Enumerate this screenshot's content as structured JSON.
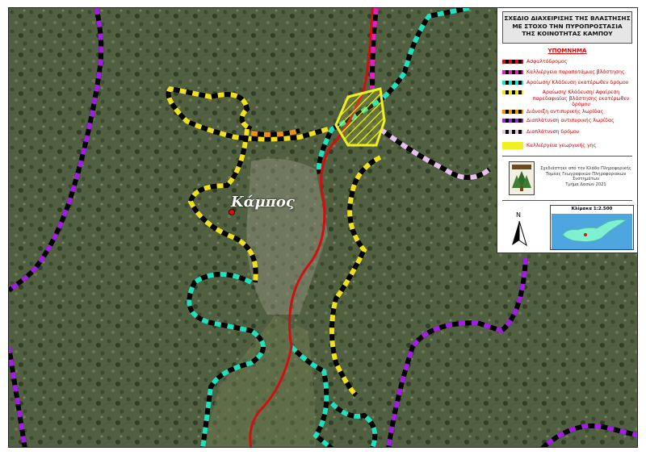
{
  "map": {
    "village_label": "Κάμπος"
  },
  "legend": {
    "title_line1": "ΣΧΕΔΙΟ ΔΙΑΧΕΙΡΙΣΗΣ ΤΗΣ ΒΛΑΣΤΗΣΗΣ",
    "title_line2": "ΜΕ ΣΤΟΧΟ ΤΗΝ ΠΥΡΟΠΡΟΣΤΑΣΙΑ",
    "title_line3": "ΤΗΣ ΚΟΙΝΟΤΗΤΑΣ ΚΑΜΠΟΥ",
    "heading": "ΥΠΟΜΝΗΜΑ",
    "items": [
      {
        "label": "Ασφαλτόδρομος",
        "color1": "#d01010",
        "color2": "#000000"
      },
      {
        "label": "Καλλιέργεια παραποτάμιας βλάστησης",
        "color1": "#e020c0",
        "color2": "#000000"
      },
      {
        "label": "Αραίωση/ Κλάδευση εκατέρωθεν δρόμου",
        "color1": "#20e0c0",
        "color2": "#000000"
      },
      {
        "label": "Αραίωση/ Κλάδευση/ Αφαίρεση παρεδαφιαίας βλάστησης εκατέρωθεν δρόμου",
        "color1": "#f0e020",
        "color2": "#000000"
      },
      {
        "label": "Διάνοιξη αντιπυρικής λωρίδας",
        "color1": "#f09010",
        "color2": "#000000"
      },
      {
        "label": "Διαπλάτυνση αντιπυρικής λωρίδας",
        "color1": "#a020e0",
        "color2": "#000000"
      },
      {
        "label": "Διαπλάτυνση δρόμου",
        "color1": "#e8c0f0",
        "color2": "#000000"
      },
      {
        "label": "Καλλιέργεια γεωργικής γης",
        "color1": "#f0f020",
        "color2": "#f0f020"
      }
    ],
    "credit_line1": "Σχεδιάστηκε από τον Κλάδο Πληροφορικής",
    "credit_line2": "Τομέας Γεωγραφικών Πληροφοριακών Συστημάτων",
    "credit_line3": "Τμήμα Δασών  2021",
    "north_label": "N",
    "scale_label": "Κλίμακα 1:2.500"
  },
  "colors": {
    "terrain": "#4a5a3a",
    "road_red": "#d01010",
    "cyan": "#20e0c0",
    "yellow": "#f0e020",
    "purple": "#a020e0",
    "magenta": "#e020c0",
    "orange": "#f09010",
    "lilac": "#e8c0f0"
  }
}
